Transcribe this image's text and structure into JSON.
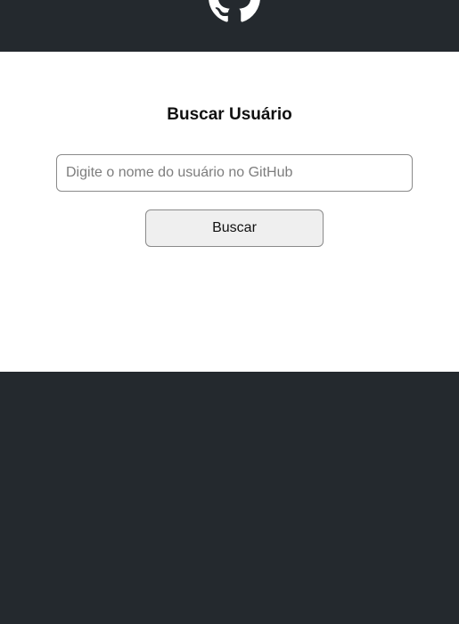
{
  "header": {
    "logo_icon": "github-icon"
  },
  "main": {
    "title": "Buscar Usuário",
    "search": {
      "placeholder": "Digite o nome do usuário no GitHub",
      "value": ""
    },
    "button_label": "Buscar"
  },
  "colors": {
    "dark_background": "#24292e",
    "content_background": "#ffffff",
    "button_background": "#efefef"
  }
}
